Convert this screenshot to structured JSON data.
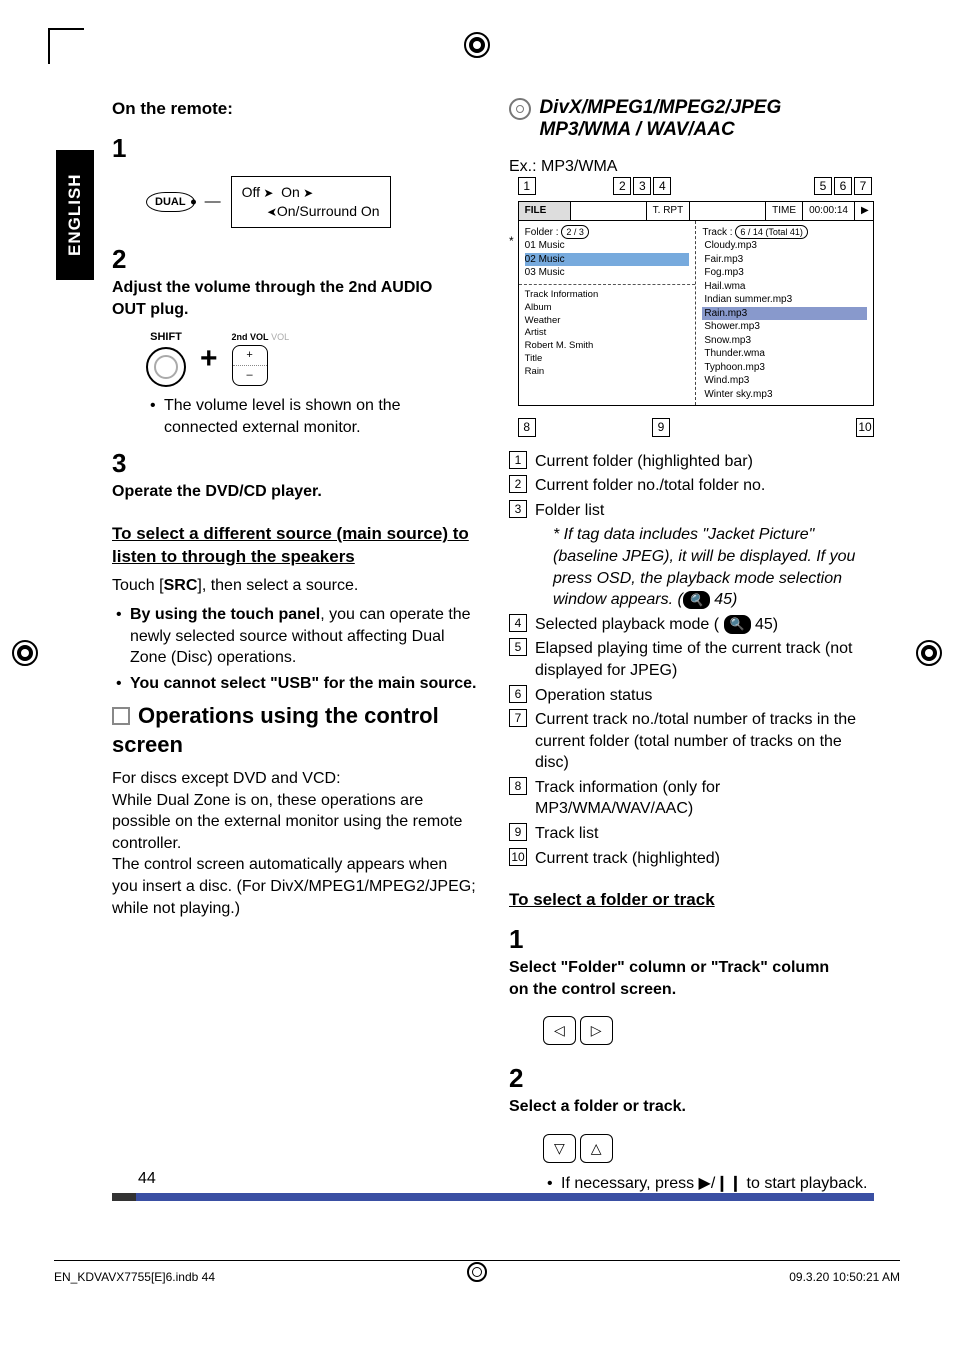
{
  "lang_tab": "ENGLISH",
  "left": {
    "on_remote": "On the remote:",
    "step1_num": "1",
    "dual_btn": "DUAL",
    "cycle": {
      "off": "Off",
      "on": "On",
      "surround": "On/Surround On"
    },
    "step2_num": "2",
    "step2_title": "Adjust the volume through the 2nd AUDIO OUT plug.",
    "shift_label": "SHIFT",
    "plus": "+",
    "vol_label": "2nd VOL",
    "vol_label_grey": "VOL",
    "vol_plus": "+",
    "vol_minus": "–",
    "step2_note": "The volume level is shown on the connected external monitor.",
    "step3_num": "3",
    "step3_title": "Operate the DVD/CD player.",
    "select_src_heading": "To select a different source (main source) to listen to through the speakers",
    "select_src_line_a": "Touch [",
    "select_src_line_b": "SRC",
    "select_src_line_c": "], then select a source.",
    "select_src_b1a": "By using the touch panel",
    "select_src_b1b": ", you can operate the newly selected source without affecting Dual Zone (Disc) operations.",
    "select_src_b2": "You cannot select \"USB\" for the main source.",
    "ops_heading": "Operations using the control screen",
    "ops_p1": "For discs except DVD and VCD:",
    "ops_p2": "While Dual Zone is on, these operations are possible on the external monitor using the remote controller.",
    "ops_p3": "The control screen automatically appears when you insert a disc. (For DivX/MPEG1/MPEG2/JPEG; while not playing.)"
  },
  "right": {
    "fmt_line1": "DivX/MPEG1/MPEG2/JPEG",
    "fmt_line2": "MP3/WMA / WAV/AAC",
    "ex_label": "Ex.: MP3/WMA",
    "markers_top": [
      "1",
      "2",
      "3",
      "4",
      "5",
      "6",
      "7"
    ],
    "markers_bot": [
      "8",
      "9",
      "10"
    ],
    "ctrl": {
      "file": "FILE",
      "trpt": "T. RPT",
      "time_lbl": "TIME",
      "time_val": "00:00:14",
      "play": "▶",
      "folder_lbl": "Folder :",
      "folder_val": "2 / 3",
      "track_lbl": "Track :",
      "track_val": "6 / 14 (Total 41)",
      "folders": [
        "01 Music",
        "02 Music",
        "03 Music"
      ],
      "ti_head": "Track Information",
      "ti": [
        [
          "Album",
          "Weather"
        ],
        [
          "Artist",
          "Robert M. Smith"
        ],
        [
          "Title",
          "Rain"
        ]
      ],
      "tracks": [
        "Cloudy.mp3",
        "Fair.mp3",
        "Fog.mp3",
        "Hail.wma",
        "Indian summer.mp3",
        "Rain.mp3",
        "Shower.mp3",
        "Snow.mp3",
        "Thunder.wma",
        "Typhoon.mp3",
        "Wind.mp3",
        "Winter sky.mp3"
      ]
    },
    "legend": {
      "i1": "Current folder (highlighted bar)",
      "i2": "Current folder no./total folder no.",
      "i3": "Folder list",
      "i3_note": "*  If tag data includes \"Jacket Picture\" (baseline JPEG), it will be displayed. If you press OSD, the playback mode selection window appears. (",
      "i3_note_ref": "45)",
      "i4a": "Selected playback mode ( ",
      "i4b": " 45)",
      "i5": "Elapsed playing time of the current track (not displayed for JPEG)",
      "i6": "Operation status",
      "i7": "Current track no./total number of tracks in the current folder (total number of tracks on the disc)",
      "i8": "Track information (only for MP3/WMA/WAV/AAC)",
      "i9": "Track list",
      "i10": "Current track (highlighted)"
    },
    "sel_heading": "To select a folder or track",
    "sel_s1_num": "1",
    "sel_s1": "Select \"Folder\" column or \"Track\" column on the control screen.",
    "key_left": "◁",
    "key_right": "▷",
    "sel_s2_num": "2",
    "sel_s2": "Select a folder or track.",
    "key_down": "▽",
    "key_up": "△",
    "sel_note": "If necessary, press ▶/❙❙ to start playback."
  },
  "page_number": "44",
  "footer_left": "EN_KDVAVX7755[E]6.indb   44",
  "footer_right": "09.3.20   10:50:21 AM"
}
